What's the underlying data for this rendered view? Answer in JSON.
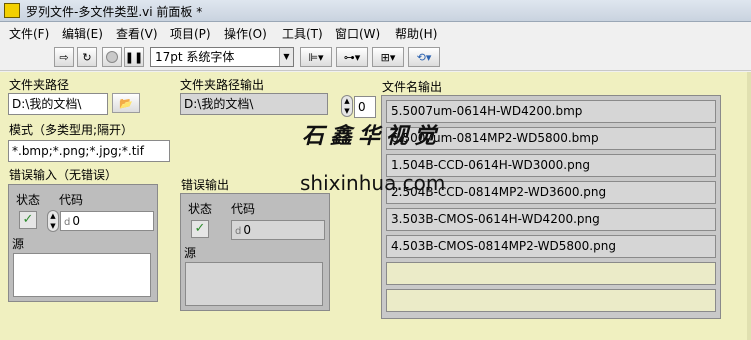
{
  "window": {
    "icon_text": "",
    "title": "罗列文件-多文件类型.vi 前面板 *"
  },
  "menu": [
    "文件(F)",
    "编辑(E)",
    "查看(V)",
    "项目(P)",
    "操作(O)",
    "工具(T)",
    "窗口(W)",
    "帮助(H)"
  ],
  "toolbar": {
    "font_select": "17pt 系统字体"
  },
  "panel": {
    "folder_path_label": "文件夹路径",
    "folder_path_value": "D:\\我的文档\\",
    "folder_path_out_label": "文件夹路径输出",
    "folder_path_out_value": "D:\\我的文档\\",
    "filename_out_label": "文件名输出",
    "index_value": "0",
    "pattern_label": "模式（多类型用;隔开）",
    "pattern_value": "*.bmp;*.png;*.jpg;*.tif",
    "error_in": {
      "label": "错误输入（无错误）",
      "status_label": "状态",
      "code_label": "代码",
      "code_value": "0",
      "source_label": "源",
      "prefix": "d"
    },
    "error_out": {
      "label": "错误输出",
      "status_label": "状态",
      "code_label": "代码",
      "code_value": "0",
      "source_label": "源",
      "prefix": "d"
    },
    "filenames": [
      "5.5007um-0614H-WD4200.bmp",
      "6.5007um-0814MP2-WD5800.bmp",
      "1.504B-CCD-0614H-WD3000.png",
      "2.504B-CCD-0814MP2-WD3600.png",
      "3.503B-CMOS-0614H-WD4200.png",
      "4.503B-CMOS-0814MP2-WD5800.png"
    ]
  },
  "watermark": {
    "line1": "石鑫华视觉",
    "line2": "shixinhua.com"
  }
}
